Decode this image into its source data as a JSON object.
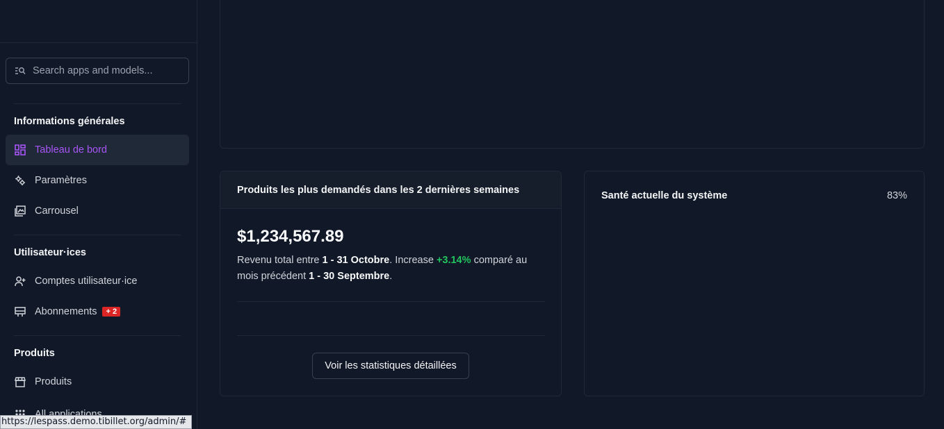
{
  "sidebar": {
    "search_placeholder": "Search apps and models...",
    "sections": [
      {
        "title": "Informations générales"
      },
      {
        "title": "Utilisateur·ices"
      },
      {
        "title": "Produits"
      }
    ],
    "items": [
      {
        "label": "Tableau de bord",
        "icon": "dashboard-icon"
      },
      {
        "label": "Paramètres",
        "icon": "settings-icon"
      },
      {
        "label": "Carrousel",
        "icon": "gallery-icon"
      },
      {
        "label": "Comptes utilisateur·ice",
        "icon": "add-user-icon"
      },
      {
        "label": "Abonnements",
        "icon": "card-icon",
        "badge": "+ 2"
      },
      {
        "label": "Produits",
        "icon": "store-icon"
      },
      {
        "label": "All applications",
        "icon": "apps-icon"
      }
    ]
  },
  "main": {
    "products_card": {
      "title": "Produits les plus demandés dans les 2 dernières semaines",
      "amount": "$1,234,567.89",
      "desc_prefix": "Revenu total entre",
      "period_current": "1 - 31 Octobre",
      "increase_text": ". Increase",
      "increase_value": "+3.14%",
      "compare_text": "comparé au mois précédent",
      "period_previous": "1 - 30 Septembre",
      "button_label": "Voir les statistiques détaillées"
    },
    "health_card": {
      "label": "Santé actuelle du système",
      "value": "83%"
    }
  },
  "statusbar": {
    "url": "https://lespass.demo.tibillet.org/admin/#"
  },
  "colors": {
    "accent": "#a855f7",
    "positive": "#22c55e",
    "badge": "#dc2626",
    "background": "#111827"
  }
}
